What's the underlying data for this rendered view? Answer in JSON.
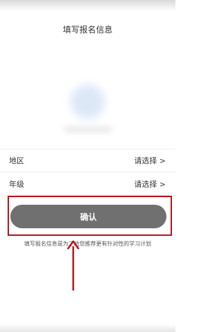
{
  "header": {
    "title": "填写报名信息"
  },
  "form": {
    "region": {
      "label": "地区",
      "value": "请选择 >"
    },
    "grade": {
      "label": "年级",
      "value": "请选择 >"
    }
  },
  "confirm_label": "确认",
  "hint": "填写报名信息是为了给您推荐更有针对性的学习计划",
  "colors": {
    "annotation_red": "#b5121b",
    "button_gray": "#707070"
  }
}
